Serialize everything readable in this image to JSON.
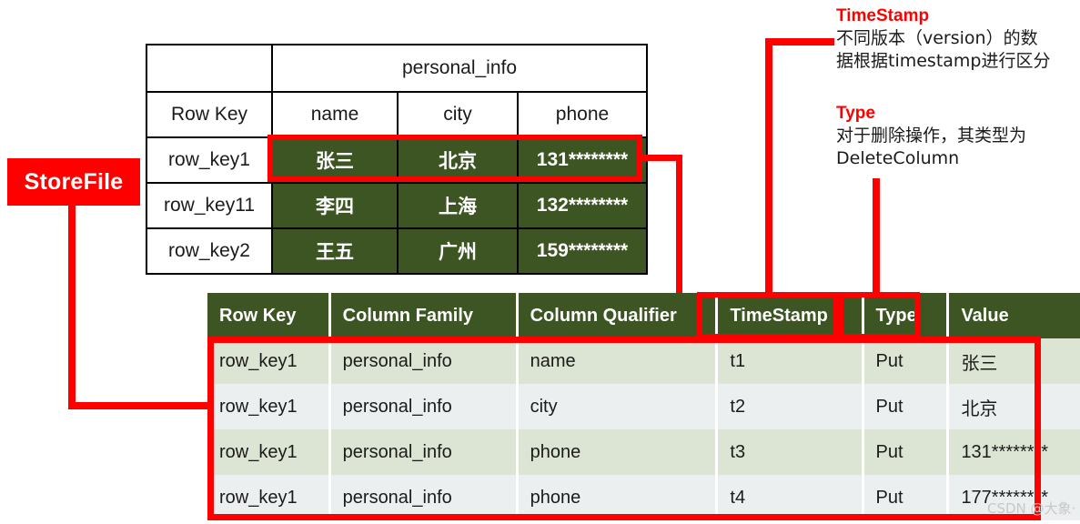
{
  "badge": {
    "label": "StoreFile"
  },
  "top_table": {
    "column_family_header": "personal_info",
    "headers": [
      "Row Key",
      "name",
      "city",
      "phone"
    ],
    "rows": [
      {
        "row_key": "row_key1",
        "name": "张三",
        "city": "北京",
        "phone": "131********"
      },
      {
        "row_key": "row_key11",
        "name": "李四",
        "city": "上海",
        "phone": "132********"
      },
      {
        "row_key": "row_key2",
        "name": "王五",
        "city": "广州",
        "phone": "159********"
      }
    ]
  },
  "bottom_table": {
    "headers": [
      "Row Key",
      "Column Family",
      "Column Qualifier",
      "TimeStamp",
      "Type",
      "Value"
    ],
    "rows": [
      {
        "row_key": "row_key1",
        "column_family": "personal_info",
        "column_qualifier": "name",
        "timestamp": "t1",
        "type": "Put",
        "value": "张三"
      },
      {
        "row_key": "row_key1",
        "column_family": "personal_info",
        "column_qualifier": "city",
        "timestamp": "t2",
        "type": "Put",
        "value": "北京"
      },
      {
        "row_key": "row_key1",
        "column_family": "personal_info",
        "column_qualifier": "phone",
        "timestamp": "t3",
        "type": "Put",
        "value": "131********"
      },
      {
        "row_key": "row_key1",
        "column_family": "personal_info",
        "column_qualifier": "phone",
        "timestamp": "t4",
        "type": "Put",
        "value": "177********"
      }
    ]
  },
  "annotations": {
    "timestamp": {
      "title": "TimeStamp",
      "line1": "不同版本（version）的数",
      "line2": "据根据timestamp进行区分"
    },
    "type": {
      "title": "Type",
      "line1": "对于删除操作，其类型为",
      "line2": "DeleteColumn"
    }
  },
  "watermark": {
    "text": "CSDN @大象·"
  },
  "colors": {
    "accent_red": "#ff0000",
    "dark_green": "#3c5522",
    "row_odd": "#dce4d3",
    "row_even": "#eceff0",
    "border_black": "#000000"
  }
}
